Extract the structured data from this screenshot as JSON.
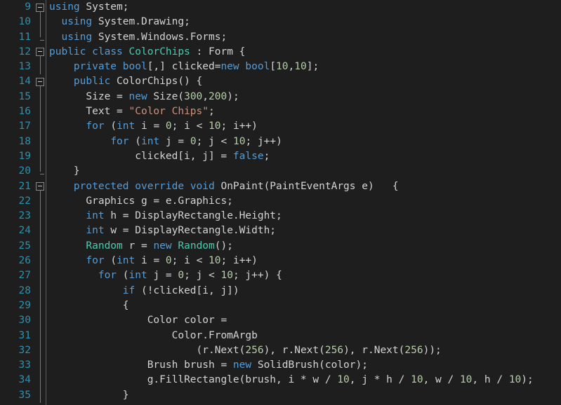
{
  "editor": {
    "language": "csharp",
    "theme": "dark",
    "first_visible_line": 9,
    "last_visible_line": 35,
    "colors": {
      "background": "#1e1e1e",
      "line_number": "#2b91af",
      "plain_text": "#d4d4d4",
      "keyword": "#569cd6",
      "type": "#4ec9b0",
      "string": "#ce9178",
      "number": "#b5cea8",
      "fold_guide": "#7a7a7a",
      "gutter_rule": "#5a5a5a"
    },
    "lines": [
      {
        "number": "9",
        "fold": "start",
        "indent": 0,
        "text": "using System;",
        "tokens": [
          {
            "t": "using",
            "c": "kw"
          },
          {
            "t": " System;",
            "c": "pln"
          }
        ]
      },
      {
        "number": "10",
        "fold": "line",
        "indent": 1,
        "text": "using System.Drawing;",
        "tokens": [
          {
            "t": "using",
            "c": "kw"
          },
          {
            "t": " System.Drawing;",
            "c": "pln"
          }
        ]
      },
      {
        "number": "11",
        "fold": "end",
        "indent": 1,
        "text": "using System.Windows.Forms;",
        "tokens": [
          {
            "t": "using",
            "c": "kw"
          },
          {
            "t": " System.Windows.Forms;",
            "c": "pln"
          }
        ]
      },
      {
        "number": "12",
        "fold": "start",
        "indent": 0,
        "text": "public class ColorChips : Form {",
        "tokens": [
          {
            "t": "public",
            "c": "kw"
          },
          {
            "t": " ",
            "c": "pln"
          },
          {
            "t": "class",
            "c": "kw"
          },
          {
            "t": " ",
            "c": "pln"
          },
          {
            "t": "ColorChips",
            "c": "typ"
          },
          {
            "t": " : Form {",
            "c": "pln"
          }
        ]
      },
      {
        "number": "13",
        "fold": "line",
        "indent": 2,
        "text": "private bool[,] clicked=new bool[10,10];",
        "tokens": [
          {
            "t": "private",
            "c": "kw"
          },
          {
            "t": " ",
            "c": "pln"
          },
          {
            "t": "bool",
            "c": "kw"
          },
          {
            "t": "[,] clicked=",
            "c": "pln"
          },
          {
            "t": "new",
            "c": "kw"
          },
          {
            "t": " ",
            "c": "pln"
          },
          {
            "t": "bool",
            "c": "kw"
          },
          {
            "t": "[",
            "c": "pln"
          },
          {
            "t": "10",
            "c": "num"
          },
          {
            "t": ",",
            "c": "pln"
          },
          {
            "t": "10",
            "c": "num"
          },
          {
            "t": "];",
            "c": "pln"
          }
        ]
      },
      {
        "number": "14",
        "fold": "start",
        "indent": 2,
        "text": "public ColorChips() {",
        "tokens": [
          {
            "t": "public",
            "c": "kw"
          },
          {
            "t": " ColorChips() {",
            "c": "pln"
          }
        ]
      },
      {
        "number": "15",
        "fold": "line",
        "indent": 3,
        "text": "Size = new Size(300,200);",
        "tokens": [
          {
            "t": "Size = ",
            "c": "pln"
          },
          {
            "t": "new",
            "c": "kw"
          },
          {
            "t": " Size(",
            "c": "pln"
          },
          {
            "t": "300",
            "c": "num"
          },
          {
            "t": ",",
            "c": "pln"
          },
          {
            "t": "200",
            "c": "num"
          },
          {
            "t": ");",
            "c": "pln"
          }
        ]
      },
      {
        "number": "16",
        "fold": "line",
        "indent": 3,
        "text": "Text = \"Color Chips\";",
        "tokens": [
          {
            "t": "Text = ",
            "c": "pln"
          },
          {
            "t": "\"Color Chips\"",
            "c": "str"
          },
          {
            "t": ";",
            "c": "pln"
          }
        ]
      },
      {
        "number": "17",
        "fold": "line",
        "indent": 3,
        "text": "for (int i = 0; i < 10; i++)",
        "tokens": [
          {
            "t": "for",
            "c": "kw"
          },
          {
            "t": " (",
            "c": "pln"
          },
          {
            "t": "int",
            "c": "kw"
          },
          {
            "t": " i = ",
            "c": "pln"
          },
          {
            "t": "0",
            "c": "num"
          },
          {
            "t": "; i < ",
            "c": "pln"
          },
          {
            "t": "10",
            "c": "num"
          },
          {
            "t": "; i++)",
            "c": "pln"
          }
        ]
      },
      {
        "number": "18",
        "fold": "line",
        "indent": 5,
        "text": "for (int j = 0; j < 10; j++)",
        "tokens": [
          {
            "t": "for",
            "c": "kw"
          },
          {
            "t": " (",
            "c": "pln"
          },
          {
            "t": "int",
            "c": "kw"
          },
          {
            "t": " j = ",
            "c": "pln"
          },
          {
            "t": "0",
            "c": "num"
          },
          {
            "t": "; j < ",
            "c": "pln"
          },
          {
            "t": "10",
            "c": "num"
          },
          {
            "t": "; j++)",
            "c": "pln"
          }
        ]
      },
      {
        "number": "19",
        "fold": "line",
        "indent": 7,
        "text": "clicked[i, j] = false;",
        "tokens": [
          {
            "t": "clicked[i, j] = ",
            "c": "pln"
          },
          {
            "t": "false",
            "c": "kw"
          },
          {
            "t": ";",
            "c": "pln"
          }
        ]
      },
      {
        "number": "20",
        "fold": "end",
        "indent": 2,
        "text": "}",
        "tokens": [
          {
            "t": "}",
            "c": "pln"
          }
        ]
      },
      {
        "number": "21",
        "fold": "start",
        "indent": 2,
        "text": "protected override void OnPaint(PaintEventArgs e)   {",
        "tokens": [
          {
            "t": "protected",
            "c": "kw"
          },
          {
            "t": " ",
            "c": "pln"
          },
          {
            "t": "override",
            "c": "kw"
          },
          {
            "t": " ",
            "c": "pln"
          },
          {
            "t": "void",
            "c": "kw"
          },
          {
            "t": " OnPaint(PaintEventArgs e)   {",
            "c": "pln"
          }
        ]
      },
      {
        "number": "22",
        "fold": "line",
        "indent": 3,
        "text": "Graphics g = e.Graphics;",
        "tokens": [
          {
            "t": "Graphics g = e.Graphics;",
            "c": "pln"
          }
        ]
      },
      {
        "number": "23",
        "fold": "line",
        "indent": 3,
        "text": "int h = DisplayRectangle.Height;",
        "tokens": [
          {
            "t": "int",
            "c": "kw"
          },
          {
            "t": " h = DisplayRectangle.Height;",
            "c": "pln"
          }
        ]
      },
      {
        "number": "24",
        "fold": "line",
        "indent": 3,
        "text": "int w = DisplayRectangle.Width;",
        "tokens": [
          {
            "t": "int",
            "c": "kw"
          },
          {
            "t": " w = DisplayRectangle.Width;",
            "c": "pln"
          }
        ]
      },
      {
        "number": "25",
        "fold": "line",
        "indent": 3,
        "text": "Random r = new Random();",
        "tokens": [
          {
            "t": "Random",
            "c": "typ"
          },
          {
            "t": " r = ",
            "c": "pln"
          },
          {
            "t": "new",
            "c": "kw"
          },
          {
            "t": " ",
            "c": "pln"
          },
          {
            "t": "Random",
            "c": "typ"
          },
          {
            "t": "();",
            "c": "pln"
          }
        ]
      },
      {
        "number": "26",
        "fold": "line",
        "indent": 3,
        "text": "for (int i = 0; i < 10; i++)",
        "tokens": [
          {
            "t": "for",
            "c": "kw"
          },
          {
            "t": " (",
            "c": "pln"
          },
          {
            "t": "int",
            "c": "kw"
          },
          {
            "t": " i = ",
            "c": "pln"
          },
          {
            "t": "0",
            "c": "num"
          },
          {
            "t": "; i < ",
            "c": "pln"
          },
          {
            "t": "10",
            "c": "num"
          },
          {
            "t": "; i++)",
            "c": "pln"
          }
        ]
      },
      {
        "number": "27",
        "fold": "line",
        "indent": 4,
        "text": "for (int j = 0; j < 10; j++) {",
        "tokens": [
          {
            "t": "for",
            "c": "kw"
          },
          {
            "t": " (",
            "c": "pln"
          },
          {
            "t": "int",
            "c": "kw"
          },
          {
            "t": " j = ",
            "c": "pln"
          },
          {
            "t": "0",
            "c": "num"
          },
          {
            "t": "; j < ",
            "c": "pln"
          },
          {
            "t": "10",
            "c": "num"
          },
          {
            "t": "; j++) {",
            "c": "pln"
          }
        ]
      },
      {
        "number": "28",
        "fold": "line",
        "indent": 6,
        "text": "if (!clicked[i, j])",
        "tokens": [
          {
            "t": "if",
            "c": "kw"
          },
          {
            "t": " (!clicked[i, j])",
            "c": "pln"
          }
        ]
      },
      {
        "number": "29",
        "fold": "line",
        "indent": 6,
        "text": "{",
        "tokens": [
          {
            "t": "{",
            "c": "pln"
          }
        ]
      },
      {
        "number": "30",
        "fold": "line",
        "indent": 8,
        "text": "Color color =",
        "tokens": [
          {
            "t": "Color color =",
            "c": "pln"
          }
        ]
      },
      {
        "number": "31",
        "fold": "line",
        "indent": 10,
        "text": "Color.FromArgb",
        "tokens": [
          {
            "t": "Color.FromArgb",
            "c": "pln"
          }
        ]
      },
      {
        "number": "32",
        "fold": "line",
        "indent": 12,
        "text": "(r.Next(256), r.Next(256), r.Next(256));",
        "tokens": [
          {
            "t": "(r.Next(",
            "c": "pln"
          },
          {
            "t": "256",
            "c": "num"
          },
          {
            "t": "), r.Next(",
            "c": "pln"
          },
          {
            "t": "256",
            "c": "num"
          },
          {
            "t": "), r.Next(",
            "c": "pln"
          },
          {
            "t": "256",
            "c": "num"
          },
          {
            "t": "));",
            "c": "pln"
          }
        ]
      },
      {
        "number": "33",
        "fold": "line",
        "indent": 8,
        "text": "Brush brush = new SolidBrush(color);",
        "tokens": [
          {
            "t": "Brush brush = ",
            "c": "pln"
          },
          {
            "t": "new",
            "c": "kw"
          },
          {
            "t": " SolidBrush(color);",
            "c": "pln"
          }
        ]
      },
      {
        "number": "34",
        "fold": "line",
        "indent": 8,
        "text": "g.FillRectangle(brush, i * w / 10, j * h / 10, w / 10, h / 10);",
        "tokens": [
          {
            "t": "g.FillRectangle(brush, i * w / ",
            "c": "pln"
          },
          {
            "t": "10",
            "c": "num"
          },
          {
            "t": ", j * h / ",
            "c": "pln"
          },
          {
            "t": "10",
            "c": "num"
          },
          {
            "t": ", w / ",
            "c": "pln"
          },
          {
            "t": "10",
            "c": "num"
          },
          {
            "t": ", h / ",
            "c": "pln"
          },
          {
            "t": "10",
            "c": "num"
          },
          {
            "t": ");",
            "c": "pln"
          }
        ]
      },
      {
        "number": "35",
        "fold": "line",
        "indent": 6,
        "text": "}",
        "tokens": [
          {
            "t": "}",
            "c": "pln"
          }
        ]
      }
    ]
  }
}
